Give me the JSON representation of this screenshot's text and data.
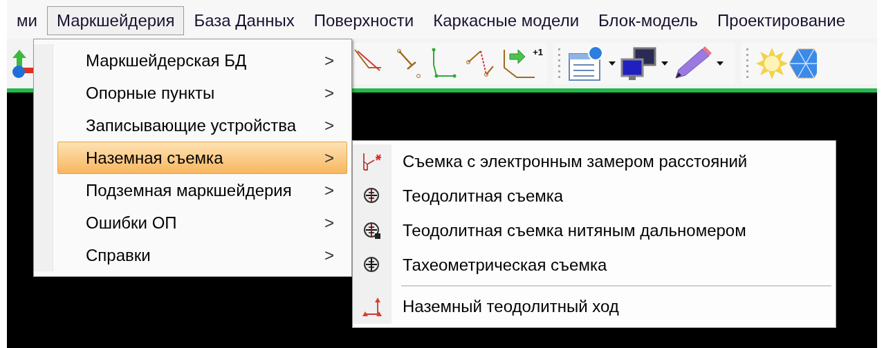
{
  "menubar": [
    {
      "label": "ми",
      "selected": false
    },
    {
      "label": "Маркшейдерия",
      "selected": true
    },
    {
      "label": "База Данных",
      "selected": false
    },
    {
      "label": "Поверхности",
      "selected": false
    },
    {
      "label": "Каркасные модели",
      "selected": false
    },
    {
      "label": "Блок-модель",
      "selected": false
    },
    {
      "label": "Проектирование",
      "selected": false
    }
  ],
  "toolbar": {
    "badge": "+1"
  },
  "menu": [
    {
      "label": "Маркшейдерская БД",
      "arrow": ">",
      "selected": false
    },
    {
      "label": "Опорные пункты",
      "arrow": ">",
      "selected": false
    },
    {
      "label": "Записывающие устройства",
      "arrow": ">",
      "selected": false
    },
    {
      "label": "Наземная съемка",
      "arrow": ">",
      "selected": true
    },
    {
      "label": "Подземная маркшейдерия",
      "arrow": ">",
      "selected": false
    },
    {
      "label": "Ошибки ОП",
      "arrow": ">",
      "selected": false
    },
    {
      "label": "Справки",
      "arrow": ">",
      "selected": false
    }
  ],
  "submenu": [
    {
      "label": "Съемка с электронным замером расстояний",
      "kind": "distance",
      "separator_before": false
    },
    {
      "label": "Теодолитная съемка",
      "kind": "theodolite",
      "separator_before": false
    },
    {
      "label": "Теодолитная съемка нитяным дальномером",
      "kind": "rangefinder",
      "separator_before": false
    },
    {
      "label": "Тахеометрическая съемка",
      "kind": "tacheometry",
      "separator_before": false
    },
    {
      "label": "Наземный теодолитный ход",
      "kind": "traverse",
      "separator_before": true
    }
  ]
}
